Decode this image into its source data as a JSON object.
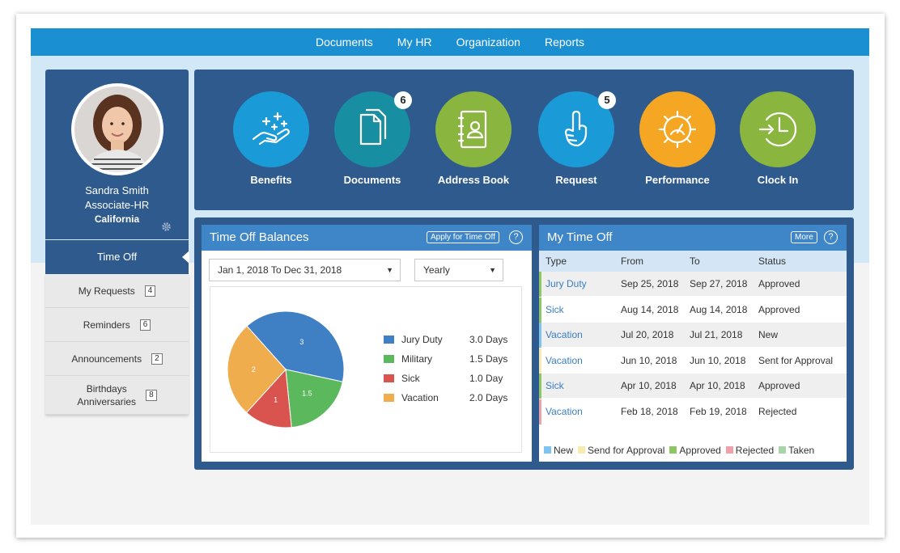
{
  "nav": {
    "items": [
      "Documents",
      "My HR",
      "Organization",
      "Reports"
    ]
  },
  "profile": {
    "name": "Sandra Smith",
    "role": "Associate-HR",
    "location": "California"
  },
  "sidebar": {
    "active": "Time Off",
    "items": [
      {
        "label": "My Requests",
        "badge": "4"
      },
      {
        "label": "Reminders",
        "badge": "6"
      },
      {
        "label": "Announcements",
        "badge": "2"
      },
      {
        "label_line1": "Birthdays",
        "label_line2": "Anniversaries",
        "badge": "8"
      }
    ]
  },
  "tiles": [
    {
      "label": "Benefits",
      "color": "#1a9ad6",
      "icon": "hand-sparkle-icon"
    },
    {
      "label": "Documents",
      "color": "#178ea1",
      "icon": "documents-icon",
      "count": "6"
    },
    {
      "label": "Address Book",
      "color": "#8ab53f",
      "icon": "address-book-icon"
    },
    {
      "label": "Request",
      "color": "#1a9ad6",
      "icon": "hand-raise-icon",
      "count": "5"
    },
    {
      "label": "Performance",
      "color": "#f5a623",
      "icon": "gauge-gear-icon"
    },
    {
      "label": "Clock In",
      "color": "#8ab53f",
      "icon": "clock-in-icon"
    }
  ],
  "balances": {
    "title": "Time Off Balances",
    "apply_label": "Apply for Time Off",
    "help": "?",
    "date_range": "Jan 1, 2018 To Dec 31, 2018",
    "period": "Yearly"
  },
  "chart_data": {
    "type": "pie",
    "categories": [
      "Jury Duty",
      "Military",
      "Sick",
      "Vacation"
    ],
    "values": [
      3,
      1.5,
      1,
      2
    ],
    "value_labels": [
      "3",
      "1.5",
      "1",
      "2"
    ],
    "legend_values": [
      "3.0 Days",
      "1.5 Days",
      "1.0 Day",
      "2.0 Days"
    ],
    "colors": [
      "#3f80c5",
      "#5cb85c",
      "#d9534f",
      "#f0ad4e"
    ],
    "legend_position": "right"
  },
  "mytimeoff": {
    "title": "My Time Off",
    "more_label": "More",
    "help": "?",
    "columns": [
      "Type",
      "From",
      "To",
      "Status"
    ],
    "rows": [
      {
        "type": "Jury Duty",
        "from": "Sep 25, 2018",
        "to": "Sep 27, 2018",
        "status": "Approved",
        "color": "#8cc665",
        "bg": "#efefef"
      },
      {
        "type": "Sick",
        "from": "Aug 14, 2018",
        "to": "Aug 14, 2018",
        "status": "Approved",
        "color": "#8cc665",
        "bg": "#ffffff"
      },
      {
        "type": "Vacation",
        "from": "Jul 20, 2018",
        "to": "Jul 21, 2018",
        "status": "New",
        "color": "#7fc4ef",
        "bg": "#efefef"
      },
      {
        "type": "Vacation",
        "from": "Jun 10, 2018",
        "to": "Jun 10, 2018",
        "status": "Sent for Approval",
        "color": "#f6ecb0",
        "bg": "#ffffff"
      },
      {
        "type": "Sick",
        "from": "Apr 10, 2018",
        "to": "Apr 10, 2018",
        "status": "Approved",
        "color": "#8cc665",
        "bg": "#efefef"
      },
      {
        "type": "Vacation",
        "from": "Feb 18, 2018",
        "to": "Feb 19, 2018",
        "status": "Rejected",
        "color": "#f0a0a8",
        "bg": "#ffffff"
      }
    ],
    "legend": [
      {
        "label": "New",
        "color": "#7fc4ef"
      },
      {
        "label": "Send for Approval",
        "color": "#f6ecb0"
      },
      {
        "label": "Approved",
        "color": "#8cc665"
      },
      {
        "label": "Rejected",
        "color": "#f0a0a8"
      },
      {
        "label": "Taken",
        "color": "#a8d5a8"
      }
    ]
  }
}
